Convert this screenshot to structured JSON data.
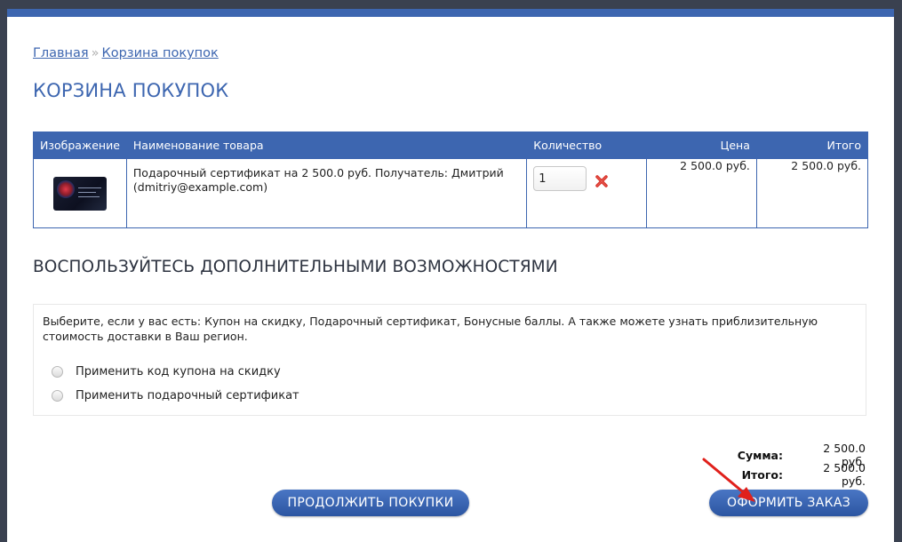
{
  "breadcrumb": {
    "home": "Главная",
    "separator": "»",
    "current": "Корзина покупок"
  },
  "page_title": "КОРЗИНА ПОКУПОК",
  "cart_table": {
    "headers": [
      "Изображение",
      "Наименование товара",
      "Количество",
      "Цена",
      "Итого"
    ],
    "rows": [
      {
        "image_icon": "gift-certificate-card-image",
        "name": "Подарочный сертификат на 2 500.0 руб. Получатель: Дмитрий (dmitriy@example.com)",
        "quantity": "1",
        "remove_icon": "remove-x-icon",
        "price": "2 500.0 руб.",
        "total": "2 500.0 руб."
      }
    ]
  },
  "extras": {
    "title": "ВОСПОЛЬЗУЙТЕСЬ ДОПОЛНИТЕЛЬНЫМИ ВОЗМОЖНОСТЯМИ",
    "description": "Выберите, если у вас есть: Купон на скидку, Подарочный сертификат, Бонусные баллы. А также можете узнать приблизительную стоимость доставки в Ваш регион.",
    "options": [
      "Применить код купона на скидку",
      "Применить подарочный сертификат"
    ]
  },
  "totals": {
    "sum_label": "Сумма:",
    "sum_value": "2 500.0 руб.",
    "total_label": "Итого:",
    "total_value": "2 500.0 руб."
  },
  "buttons": {
    "continue": "ПРОДОЛЖИТЬ ПОКУПКИ",
    "checkout": "ОФОРМИТЬ ЗАКАЗ"
  },
  "colors": {
    "accent": "#3d66b0",
    "arrow": "#e0201b",
    "remove": "#d9342b"
  }
}
